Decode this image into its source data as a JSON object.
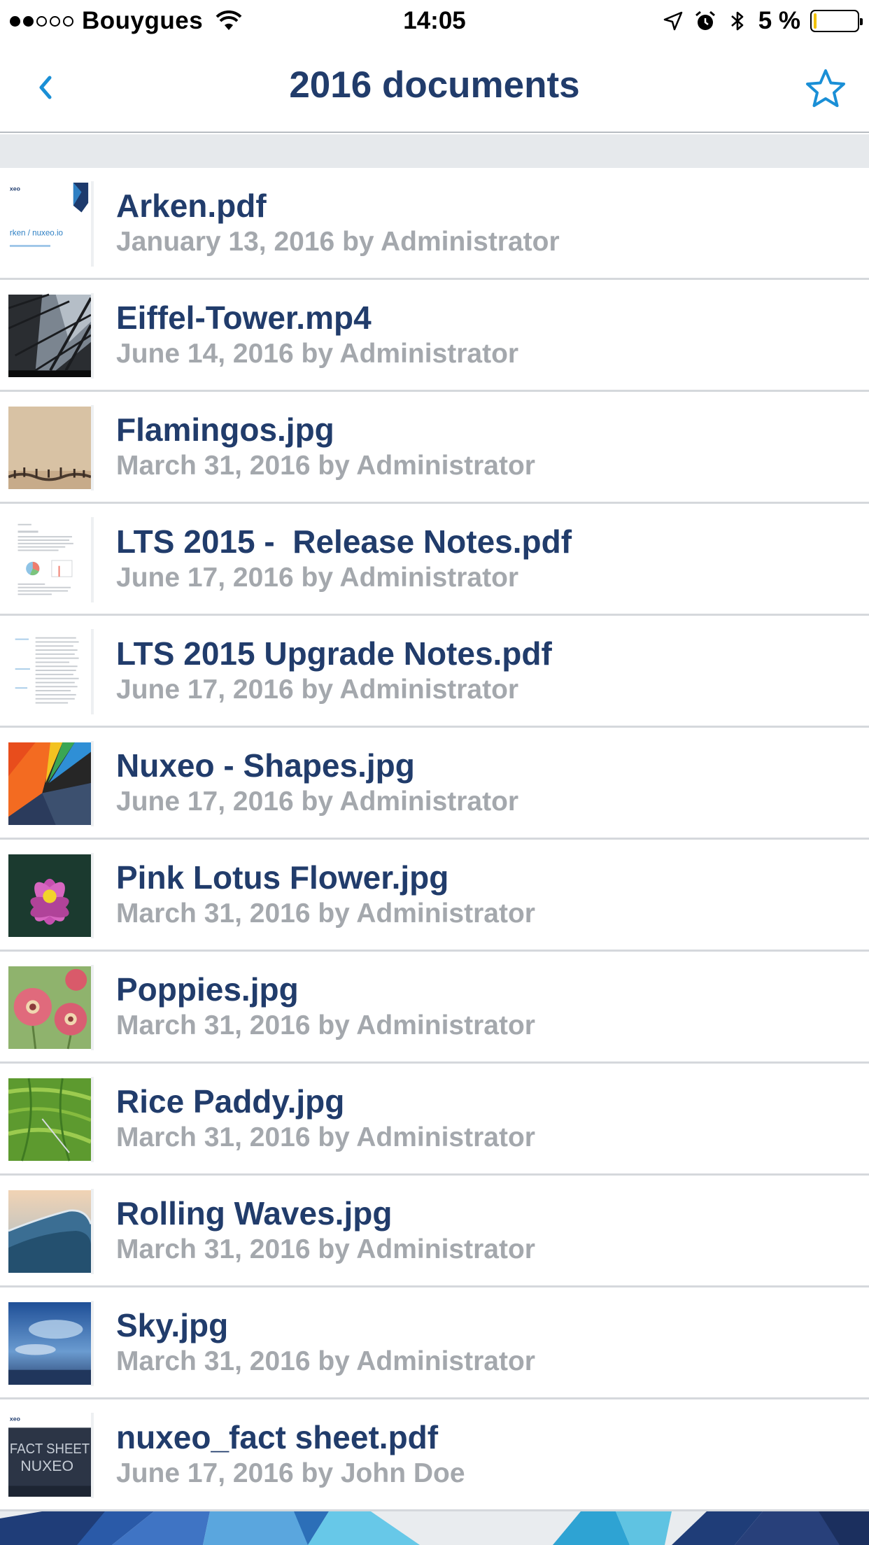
{
  "status_bar": {
    "carrier": "Bouygues",
    "time": "14:05",
    "battery_percent": "5 %",
    "battery_color": "#f2c200",
    "icons": [
      "signal-dots",
      "wifi-icon",
      "location-arrow-icon",
      "alarm-icon",
      "bluetooth-icon",
      "battery-icon"
    ]
  },
  "nav": {
    "title": "2016 documents",
    "accent_color": "#1a8fd6",
    "back_icon": "chevron-left-icon",
    "favorite_icon": "star-outline-icon"
  },
  "documents": [
    {
      "name": "Arken.pdf",
      "meta": "January 13, 2016 by Administrator",
      "thumbnail": "pdf-presentation-thumbnail",
      "thumb_label": "rken / nuxeo.io"
    },
    {
      "name": "Eiffel-Tower.mp4",
      "meta": "June 14, 2016 by Administrator",
      "thumbnail": "video-thumbnail"
    },
    {
      "name": "Flamingos.jpg",
      "meta": "March 31, 2016 by Administrator",
      "thumbnail": "photo-thumbnail"
    },
    {
      "name": "LTS 2015 -  Release Notes.pdf",
      "meta": "June 17, 2016 by Administrator",
      "thumbnail": "pdf-document-thumbnail"
    },
    {
      "name": "LTS 2015 Upgrade Notes.pdf",
      "meta": "June 17, 2016 by Administrator",
      "thumbnail": "pdf-document-thumbnail"
    },
    {
      "name": "Nuxeo - Shapes.jpg",
      "meta": "June 17, 2016 by Administrator",
      "thumbnail": "photo-thumbnail"
    },
    {
      "name": "Pink Lotus Flower.jpg",
      "meta": "March 31, 2016 by Administrator",
      "thumbnail": "photo-thumbnail"
    },
    {
      "name": "Poppies.jpg",
      "meta": "March 31, 2016 by Administrator",
      "thumbnail": "photo-thumbnail"
    },
    {
      "name": "Rice Paddy.jpg",
      "meta": "March 31, 2016 by Administrator",
      "thumbnail": "photo-thumbnail"
    },
    {
      "name": "Rolling Waves.jpg",
      "meta": "March 31, 2016 by Administrator",
      "thumbnail": "photo-thumbnail"
    },
    {
      "name": "Sky.jpg",
      "meta": "March 31, 2016 by Administrator",
      "thumbnail": "photo-thumbnail"
    },
    {
      "name": "nuxeo_fact sheet.pdf",
      "meta": "June 17, 2016 by John Doe",
      "thumbnail": "pdf-presentation-thumbnail",
      "thumb_label": "FACT SHEET NUXEO"
    }
  ],
  "colors": {
    "title_text": "#213c6b",
    "meta_text": "#a4a8ad",
    "separator": "#d5d8dc",
    "band": "#e6e9ec"
  }
}
